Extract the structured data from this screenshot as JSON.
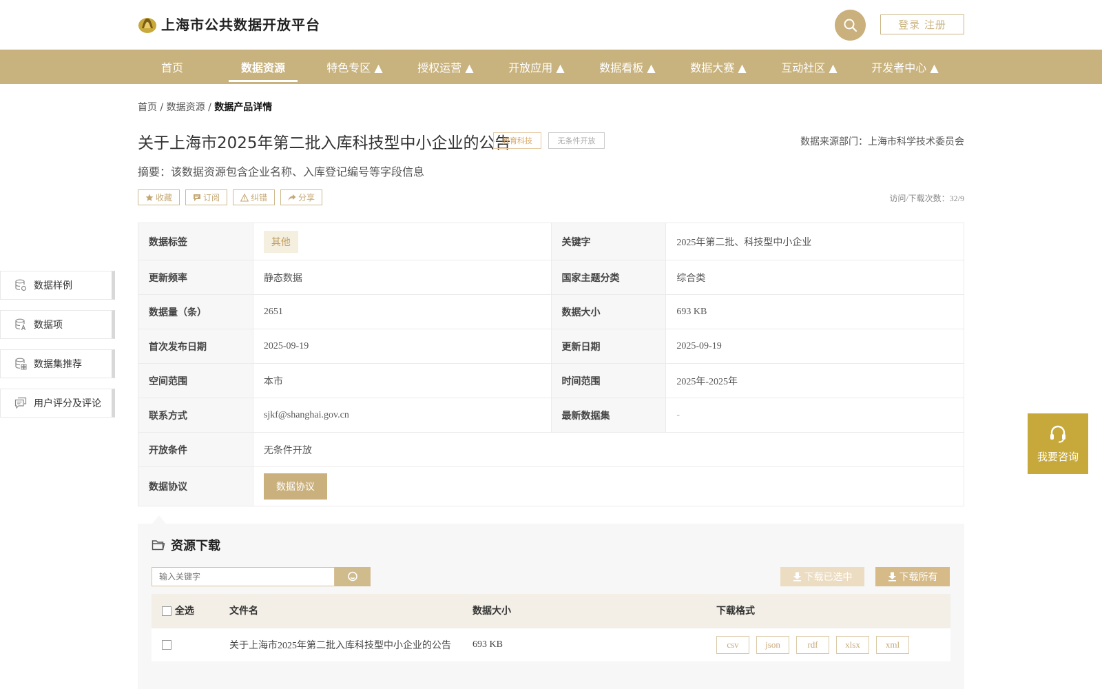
{
  "header": {
    "site_title": "上海市公共数据开放平台",
    "login_label": "登录 注册"
  },
  "nav": {
    "items": [
      {
        "label": "首页"
      },
      {
        "label": "数据资源"
      },
      {
        "label": "特色专区 ▲"
      },
      {
        "label": "授权运营 ▲"
      },
      {
        "label": "开放应用 ▲"
      },
      {
        "label": "数据看板 ▲"
      },
      {
        "label": "数据大赛 ▲"
      },
      {
        "label": "互动社区 ▲"
      },
      {
        "label": "开发者中心 ▲"
      }
    ],
    "active_index": 1
  },
  "breadcrumb": {
    "home": "首页",
    "sep": " / ",
    "resources": "数据资源",
    "current": "数据产品详情"
  },
  "dataset": {
    "title": "关于上海市2025年第二批入库科技型中小企业的公告",
    "tag_category": "教育科技",
    "tag_open": "无条件开放",
    "source": "数据来源部门：上海市科学技术委员会",
    "summary": "摘要：该数据资源包含企业名称、入库登记编号等字段信息",
    "visits": "访问/下载次数：32/9"
  },
  "actions": {
    "favorite": "收藏",
    "subscribe": "订阅",
    "report": "纠错",
    "share": "分享"
  },
  "info": {
    "label_tags": "数据标签",
    "tag_value": "其他",
    "label_keywords": "关键字",
    "keywords": "2025年第二批、科技型中小企业",
    "label_frequency": "更新频率",
    "frequency": "静态数据",
    "label_theme": "国家主题分类",
    "theme": "综合类",
    "label_count": "数据量（条）",
    "count": "2651",
    "label_size": "数据大小",
    "size": "693 KB",
    "label_first_pub": "首次发布日期",
    "first_pub": "2025-09-19",
    "label_updated": "更新日期",
    "updated": "2025-09-19",
    "label_spatial": "空间范围",
    "spatial": "本市",
    "label_time_range": "时间范围",
    "time_range": "2025年-2025年",
    "label_contact": "联系方式",
    "contact": "sjkf@shanghai.gov.cn",
    "label_latest": "最新数据集",
    "latest": "-",
    "label_condition": "开放条件",
    "condition": "无条件开放",
    "label_agreement": "数据协议",
    "agreement_button": "数据协议"
  },
  "sidebar": {
    "items": [
      {
        "label": "数据样例",
        "icon": "database-sample-icon"
      },
      {
        "label": "数据项",
        "icon": "database-field-icon"
      },
      {
        "label": "数据集推荐",
        "icon": "database-recommend-icon"
      },
      {
        "label": "用户评分及评论",
        "icon": "comment-icon"
      }
    ]
  },
  "consult": {
    "label": "我要咨询"
  },
  "download": {
    "title": "资源下载",
    "search_placeholder": "输入关键字",
    "download_selected": "下载已选中",
    "download_all": "下载所有",
    "columns": {
      "select_all": "全选",
      "filename": "文件名",
      "size": "数据大小",
      "format": "下载格式"
    },
    "rows": [
      {
        "filename": "关于上海市2025年第二批入库科技型中小企业的公告",
        "size": "693 KB",
        "formats": [
          "csv",
          "json",
          "rdf",
          "xlsx",
          "xml"
        ]
      }
    ]
  },
  "colors": {
    "brand": "#c8b27e",
    "consult": "#c6a93a"
  }
}
